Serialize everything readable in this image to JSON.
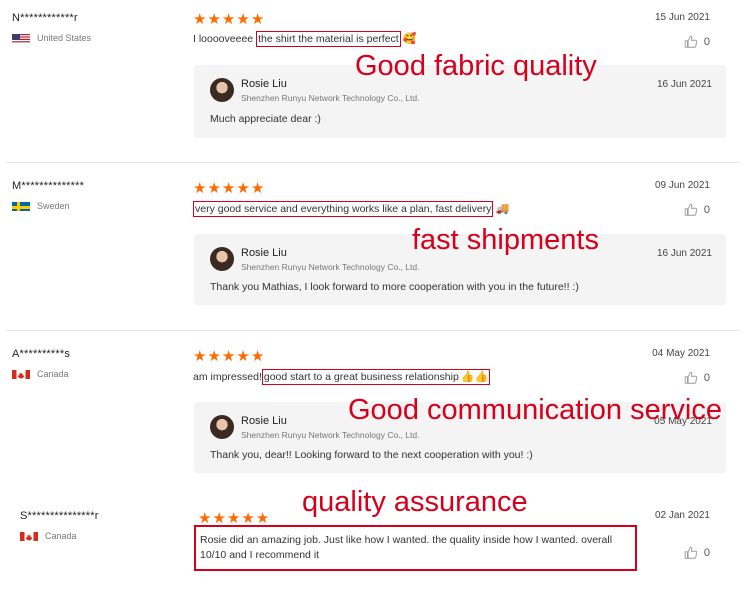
{
  "colors": {
    "star": "#ff6a00",
    "highlight": "#d6001c",
    "reply_bg": "#f4f4f4"
  },
  "reviews": [
    {
      "name": "N************r",
      "country": "United States",
      "flag": "us-flag",
      "date": "15 Jun 2021",
      "rating": 5,
      "likes": "0",
      "comment_prefix": "I looooveeee ",
      "comment_highlight": "the shirt the material is perfect",
      "emoji": "🥰",
      "reply": {
        "seller": "Rosie Liu",
        "company": "Shenzhen Runyu Network Technology Co., Ltd.",
        "date": "16 Jun 2021",
        "text": "Much appreciate dear :)"
      },
      "annotation": "Good fabric quality"
    },
    {
      "name": "M**************",
      "country": "Sweden",
      "flag": "sweden-flag",
      "date": "09 Jun 2021",
      "rating": 5,
      "likes": "0",
      "comment_prefix": "",
      "comment_highlight": "very good service and everything works like a plan, fast delivery",
      "emoji": "🚚",
      "reply": {
        "seller": "Rosie Liu",
        "company": "Shenzhen Runyu Network Technology Co., Ltd.",
        "date": "16 Jun 2021",
        "text": "Thank you Mathias, I look forward to more cooperation with you in the future!! :)"
      },
      "annotation": "fast shipments"
    },
    {
      "name": "A**********s",
      "country": "Canada",
      "flag": "canada-flag",
      "date": "04 May 2021",
      "rating": 5,
      "likes": "0",
      "comment_prefix": "am impressed!",
      "comment_highlight": "good start to a great business relationship",
      "emoji": "👍👍",
      "reply": {
        "seller": "Rosie Liu",
        "company": "Shenzhen Runyu Network Technology Co., Ltd.",
        "date": "05 May 2021",
        "text": "Thank you, dear!! Looking forward to the next cooperation with you! :)"
      },
      "annotation": "Good communication service"
    },
    {
      "name": "S***************r",
      "country": "Canada",
      "flag": "canada-flag",
      "date": "02 Jan 2021",
      "rating": 5,
      "likes": "0",
      "comment": "Rosie did an amazing job. Just like how I wanted. the quality inside how I wanted. overall 10/10 and I recommend it",
      "annotation": "quality assurance"
    }
  ]
}
